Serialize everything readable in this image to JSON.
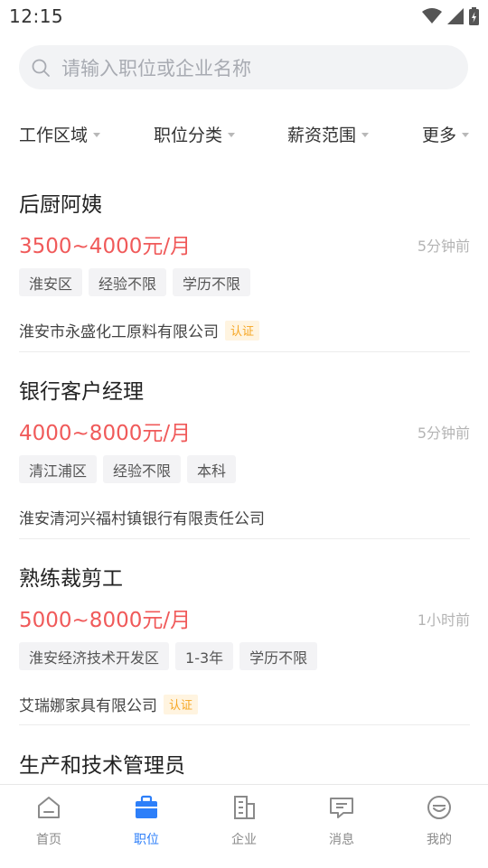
{
  "status_bar": {
    "time": "12:15",
    "icons": [
      "wifi-icon",
      "signal-icon",
      "battery-icon"
    ]
  },
  "search": {
    "placeholder": "请输入职位或企业名称",
    "icon": "search-icon"
  },
  "filters": [
    {
      "label": "工作区域"
    },
    {
      "label": "职位分类"
    },
    {
      "label": "薪资范围"
    },
    {
      "label": "更多"
    }
  ],
  "jobs": [
    {
      "title": "后厨阿姨",
      "salary": "3500~4000元/月",
      "time": "5分钟前",
      "tags": [
        "淮安区",
        "经验不限",
        "学历不限"
      ],
      "company": "淮安市永盛化工原料有限公司",
      "certified": "认证"
    },
    {
      "title": "银行客户经理",
      "salary": "4000~8000元/月",
      "time": "5分钟前",
      "tags": [
        "清江浦区",
        "经验不限",
        "本科"
      ],
      "company": "淮安清河兴福村镇银行有限责任公司",
      "certified": ""
    },
    {
      "title": "熟练裁剪工",
      "salary": "5000~8000元/月",
      "time": "1小时前",
      "tags": [
        "淮安经济技术开发区",
        "1-3年",
        "学历不限"
      ],
      "company": "艾瑞娜家具有限公司",
      "certified": "认证"
    },
    {
      "title": "生产和技术管理员"
    }
  ],
  "tabbar": [
    {
      "label": "首页",
      "icon": "home-icon",
      "active": false
    },
    {
      "label": "职位",
      "icon": "briefcase-icon",
      "active": true
    },
    {
      "label": "企业",
      "icon": "building-icon",
      "active": false
    },
    {
      "label": "消息",
      "icon": "message-icon",
      "active": false
    },
    {
      "label": "我的",
      "icon": "profile-icon",
      "active": false
    }
  ],
  "colors": {
    "accent": "#2d7ff9",
    "salary": "#f05a5a",
    "certified_text": "#f6a623",
    "certified_bg": "#fff4e0",
    "search_bg": "#f2f3f5"
  }
}
